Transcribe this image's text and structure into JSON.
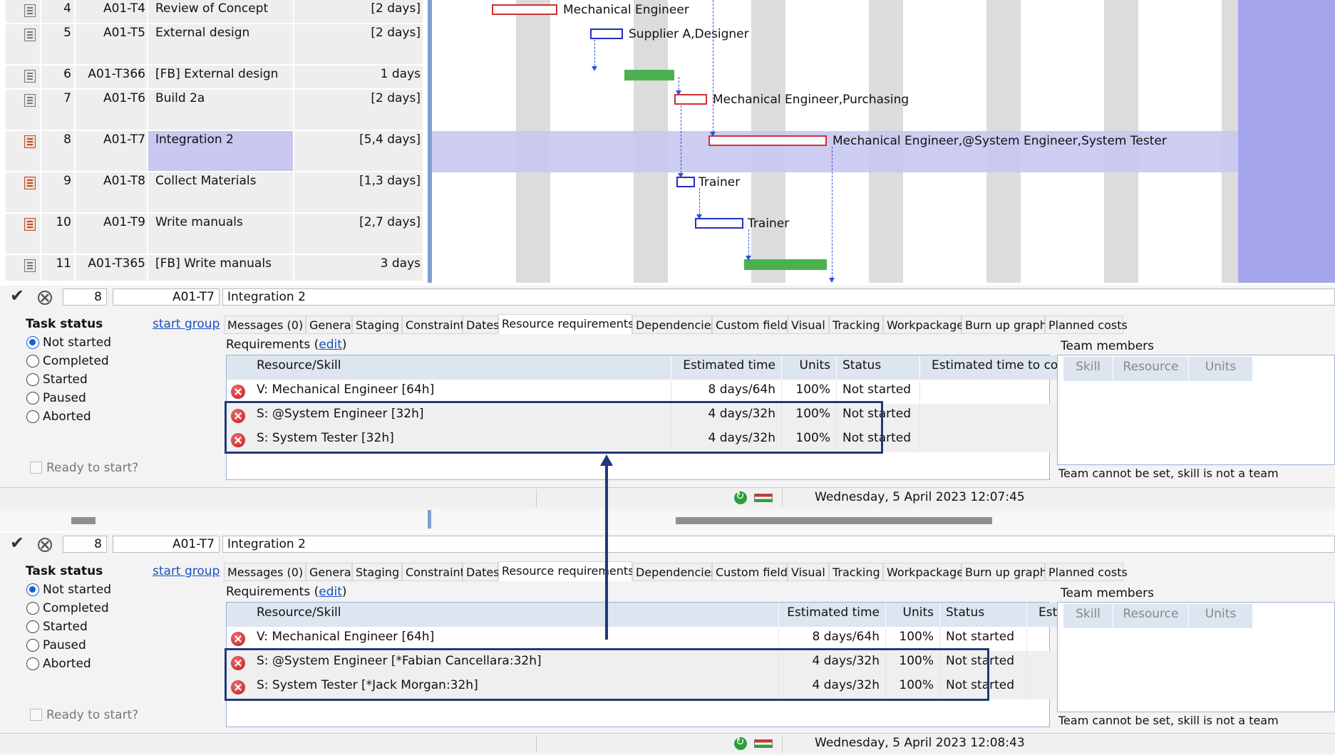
{
  "gantt": {
    "rows": [
      {
        "num": "4",
        "id": "A01-T4",
        "name": "Review of Concept",
        "dur": "[2 days]",
        "icon": "doc-icon"
      },
      {
        "num": "5",
        "id": "A01-T5",
        "name": "External design",
        "dur": "[2 days]",
        "icon": "doc-icon"
      },
      {
        "num": "6",
        "id": "A01-T366",
        "name": "[FB]  External design",
        "dur": "1 days",
        "icon": "doc-icon"
      },
      {
        "num": "7",
        "id": "A01-T6",
        "name": "Build 2a",
        "dur": "[2 days]",
        "icon": "doc-icon"
      },
      {
        "num": "8",
        "id": "A01-T7",
        "name": "Integration 2",
        "dur": "[5,4 days]",
        "icon": "doc-red-icon"
      },
      {
        "num": "9",
        "id": "A01-T8",
        "name": "Collect Materials",
        "dur": "[1,3 days]",
        "icon": "doc-red-icon"
      },
      {
        "num": "10",
        "id": "A01-T9",
        "name": "Write manuals",
        "dur": "[2,7 days]",
        "icon": "doc-red-icon"
      },
      {
        "num": "11",
        "id": "A01-T365",
        "name": "[FB]  Write manuals",
        "dur": "3 days",
        "icon": "doc-icon"
      }
    ],
    "bar_labels": {
      "r4": "Mechanical Engineer",
      "r5": "Supplier A,Designer",
      "r7": "Mechanical Engineer,Purchasing",
      "r8": "Mechanical Engineer,@System Engineer,System Tester",
      "r9": "Trainer",
      "r10": "Trainer"
    }
  },
  "panel_top": {
    "task_num": "8",
    "task_id": "A01-T7",
    "task_name": "Integration 2",
    "task_status_label": "Task status",
    "start_group": "start group",
    "statuses": [
      "Not started",
      "Completed",
      "Started",
      "Paused",
      "Aborted"
    ],
    "ready": "Ready to start?",
    "tabs": [
      "Messages (0)",
      "General",
      "Staging",
      "Constraint",
      "Dates",
      "Resource requirements",
      "Dependencies",
      "Custom fields",
      "Visual",
      "Tracking",
      "Workpackage",
      "Burn up graph",
      "Planned costs"
    ],
    "requirements_label": "Requirements (",
    "edit": "edit",
    "req_close": ")",
    "columns": [
      "Resource/Skill",
      "Estimated time",
      "Units",
      "Status",
      "Estimated time to complete"
    ],
    "rows": [
      {
        "skill": "V: Mechanical Engineer [64h]",
        "time": "8 days/64h",
        "units": "100%",
        "status": "Not started",
        "etc": ""
      },
      {
        "skill": "S: @System Engineer [32h]",
        "time": "4 days/32h",
        "units": "100%",
        "status": "Not started",
        "etc": ""
      },
      {
        "skill": "S: System Tester [32h]",
        "time": "4 days/32h",
        "units": "100%",
        "status": "Not started",
        "etc": ""
      }
    ],
    "team_members": "Team members",
    "team_cols": [
      "Skill",
      "Resource",
      "Units"
    ],
    "team_note": "Team cannot be set, skill is not a team",
    "timestamp": "Wednesday, 5 April 2023 12:07:45"
  },
  "panel_bottom": {
    "task_num": "8",
    "task_id": "A01-T7",
    "task_name": "Integration 2",
    "task_status_label": "Task status",
    "start_group": "start group",
    "statuses": [
      "Not started",
      "Completed",
      "Started",
      "Paused",
      "Aborted"
    ],
    "ready": "Ready to start?",
    "tabs": [
      "Messages (0)",
      "General",
      "Staging",
      "Constraint",
      "Dates",
      "Resource requirements",
      "Dependencies",
      "Custom fields",
      "Visual",
      "Tracking",
      "Workpackage",
      "Burn up graph",
      "Planned costs"
    ],
    "requirements_label": "Requirements (",
    "edit": "edit",
    "req_close": ")",
    "columns": [
      "Resource/Skill",
      "Estimated time",
      "Units",
      "Status",
      "Estimated time to complete"
    ],
    "rows": [
      {
        "skill": "V: Mechanical Engineer [64h]",
        "time": "8 days/64h",
        "units": "100%",
        "status": "Not started",
        "etc": ""
      },
      {
        "skill": "S: @System Engineer [*Fabian Cancellara:32h]",
        "time": "4 days/32h",
        "units": "100%",
        "status": "Not started",
        "etc": ""
      },
      {
        "skill": "S: System Tester [*Jack Morgan:32h]",
        "time": "4 days/32h",
        "units": "100%",
        "status": "Not started",
        "etc": ""
      }
    ],
    "team_members": "Team members",
    "team_cols": [
      "Skill",
      "Resource",
      "Units"
    ],
    "team_note": "Team cannot be set, skill is not a team",
    "timestamp": "Wednesday, 5 April 2023 12:08:43"
  },
  "colors": {
    "highlight": "#1f3a7a",
    "selection": "#c8c8f0",
    "bar_red": "#d03030",
    "bar_blue": "#2030c0",
    "bar_green": "#4cb050"
  }
}
